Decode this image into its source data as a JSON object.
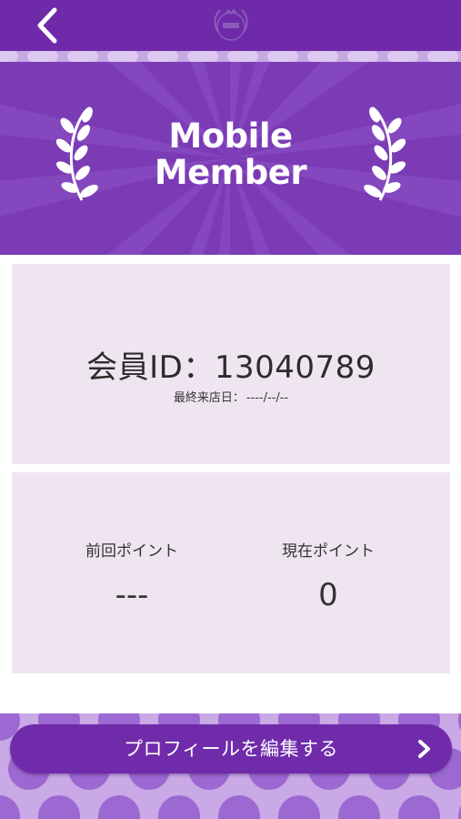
{
  "header": {
    "back_icon": "chevron-left-icon",
    "logo_icon": "crest-logo-icon"
  },
  "hero": {
    "title_line1": "Mobile",
    "title_line2": "Member"
  },
  "member": {
    "id_text": "会員ID：13040789",
    "last_visit_label": "最終来店日：",
    "last_visit_value": "----/--/--"
  },
  "points": {
    "previous_label": "前回ポイント",
    "previous_value": "---",
    "current_label": "現在ポイント",
    "current_value": "0"
  },
  "footer": {
    "edit_profile_label": "プロフィールを編集する",
    "edit_icon": "chevron-right-icon"
  },
  "colors": {
    "header_purple": "#6e2aa9",
    "hero_purple": "#7a3bb5",
    "card_bg": "#efe5f1",
    "button_purple": "#702bab",
    "polka_bg": "#c9a9e6",
    "polka_dot": "#9b69d1"
  }
}
